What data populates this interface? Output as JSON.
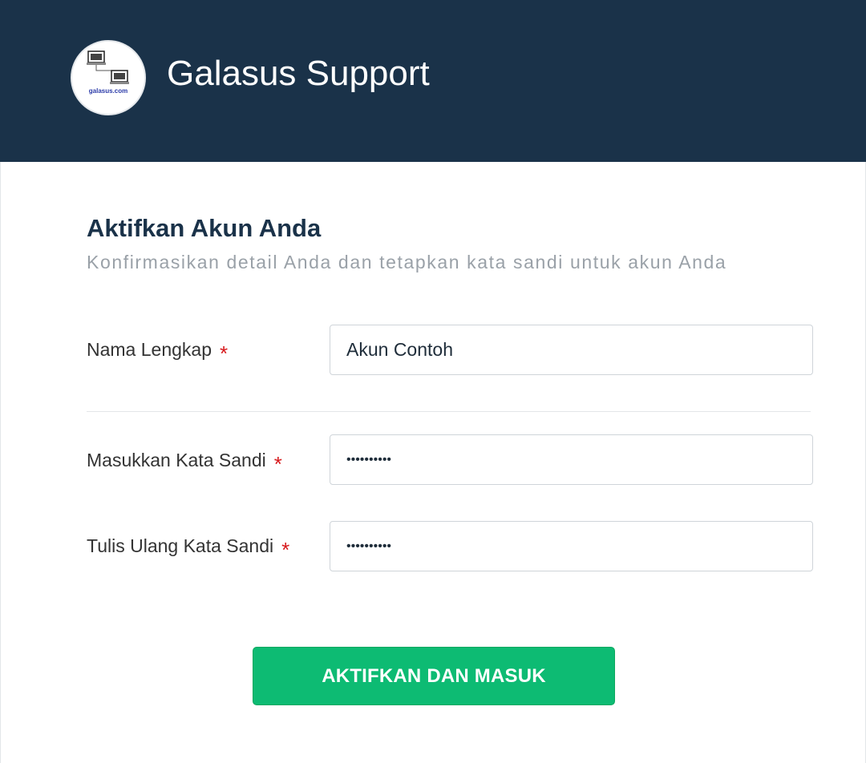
{
  "header": {
    "brand_name": "Galasus Support",
    "logo_text": "galasus.com"
  },
  "form": {
    "title": "Aktifkan Akun Anda",
    "subtitle": "Konfirmasikan detail Anda dan tetapkan kata sandi untuk akun Anda",
    "required_marker": "*",
    "fields": [
      {
        "label": "Nama Lengkap",
        "value": "Akun Contoh",
        "type": "text"
      },
      {
        "label": "Masukkan Kata Sandi",
        "value": "••••••••••",
        "type": "password"
      },
      {
        "label": "Tulis Ulang Kata Sandi",
        "value": "••••••••••",
        "type": "password"
      }
    ],
    "submit_label": "AKTIFKAN DAN MASUK"
  },
  "colors": {
    "header_bg": "#1a3249",
    "accent_green": "#0dbb73",
    "required_red": "#d7191c"
  }
}
